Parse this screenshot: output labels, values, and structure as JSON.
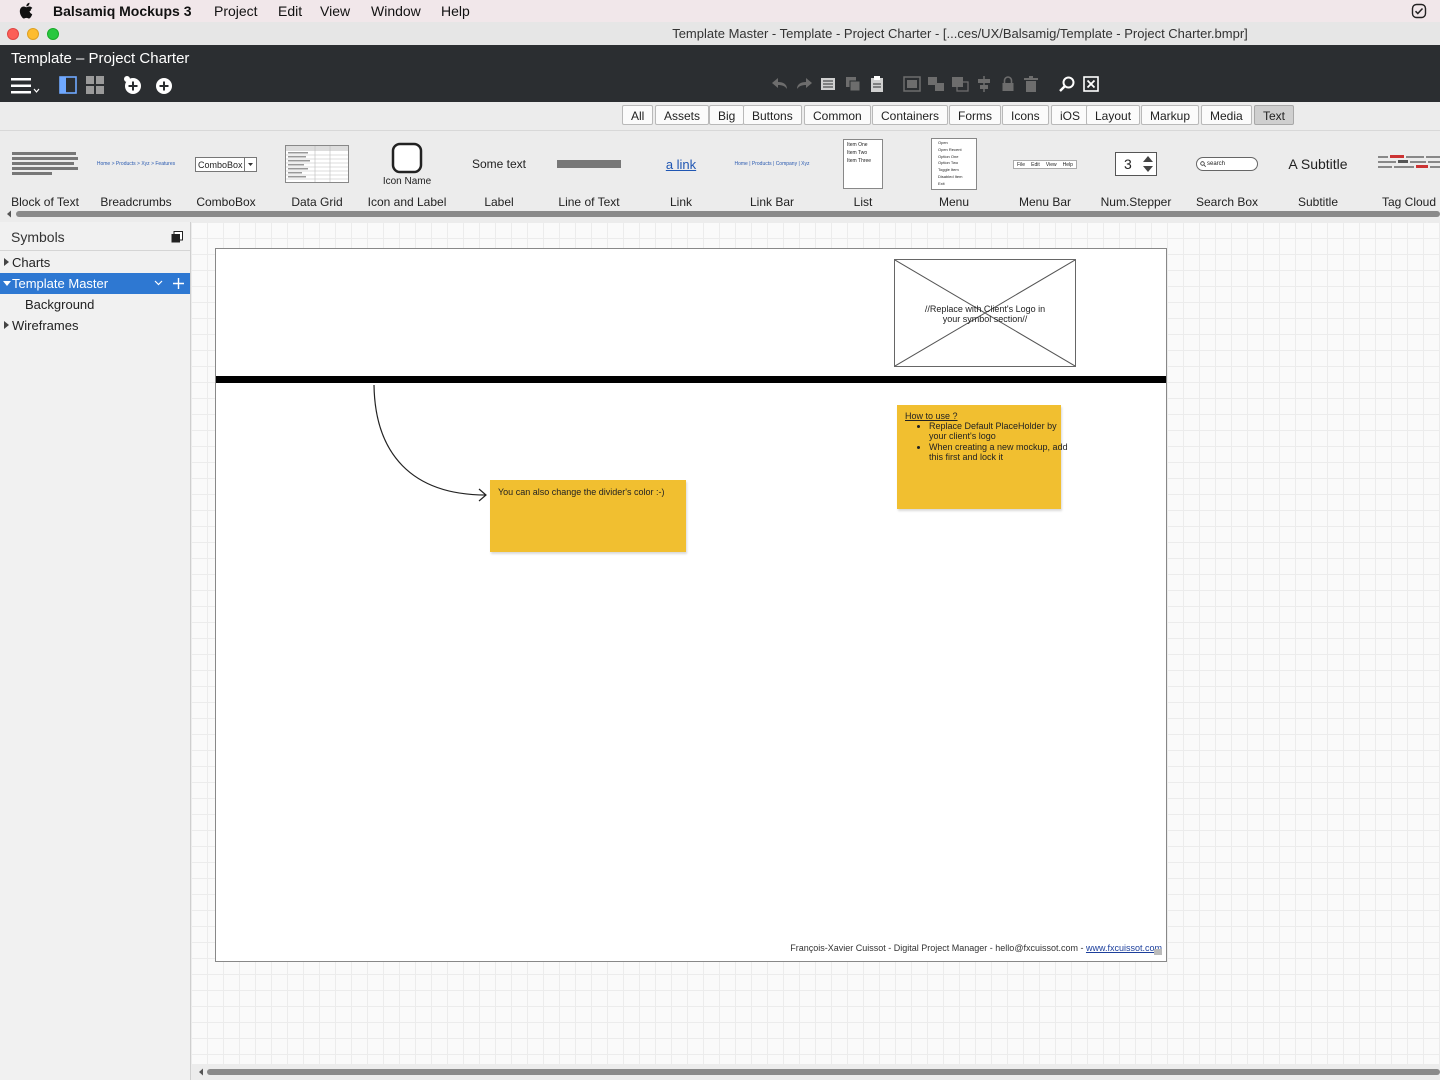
{
  "menubar": {
    "app_name": "Balsamiq Mockups 3",
    "items": [
      "Project",
      "Edit",
      "View",
      "Window",
      "Help"
    ]
  },
  "window": {
    "title": "Template Master - Template - Project Charter - [...ces/UX/Balsamig/Template - Project Charter.bmpr]"
  },
  "header": {
    "doc_title": "Template – Project Charter"
  },
  "filters": [
    "All",
    "Assets",
    "Big",
    "Buttons",
    "Common",
    "Containers",
    "Forms",
    "Icons",
    "iOS",
    "Layout",
    "Markup",
    "Media",
    "Text"
  ],
  "active_filter": "Text",
  "library": {
    "items": [
      "Block of Text",
      "Breadcrumbs",
      "ComboBox",
      "Data Grid",
      "Icon and Label",
      "Label",
      "Line of Text",
      "Link",
      "Link Bar",
      "List",
      "Menu",
      "Menu Bar",
      "Num.Stepper",
      "Search Box",
      "Subtitle",
      "Tag Cloud"
    ],
    "previews": {
      "breadcrumbs": "Home > Products > Xyz > Features",
      "combobox": "ComboBox",
      "icon_label": "Icon Name",
      "label": "Some text",
      "link": "a link",
      "linkbar": "Home | Products | Company | Xyz",
      "list": [
        "Item One",
        "Item Two",
        "Item Three"
      ],
      "menu": [
        "Open",
        "Open Recent",
        "Option One",
        "Option Two",
        "Toggle Item",
        "Disabled Item",
        "Exit"
      ],
      "menubar": [
        "File",
        "Edit",
        "View",
        "Help"
      ],
      "stepper": "3",
      "search": "search",
      "subtitle": "A Subtitle"
    }
  },
  "sidebar": {
    "title": "Symbols",
    "tree": [
      {
        "label": "Charts"
      },
      {
        "label": "Template Master"
      },
      {
        "label": "Background"
      },
      {
        "label": "Wireframes"
      }
    ]
  },
  "mockup": {
    "logo_placeholder": "//Replace with Client's Logo in your symbol section//",
    "sticky_divider": "You can also change the divider's color :-)",
    "howto": {
      "title": "How to use ?",
      "items": [
        "Replace Default PlaceHolder by your client's logo",
        "When creating a new mockup, add this first and lock it"
      ]
    },
    "footer_text": "François-Xavier Cuissot - Digital Project Manager - hello@fxcuissot.com - ",
    "footer_link": "www.fxcuissot.com"
  },
  "colors": {
    "sticky": "#f1bf30",
    "selection": "#2e78d2",
    "header_bg": "#2b2e31"
  }
}
